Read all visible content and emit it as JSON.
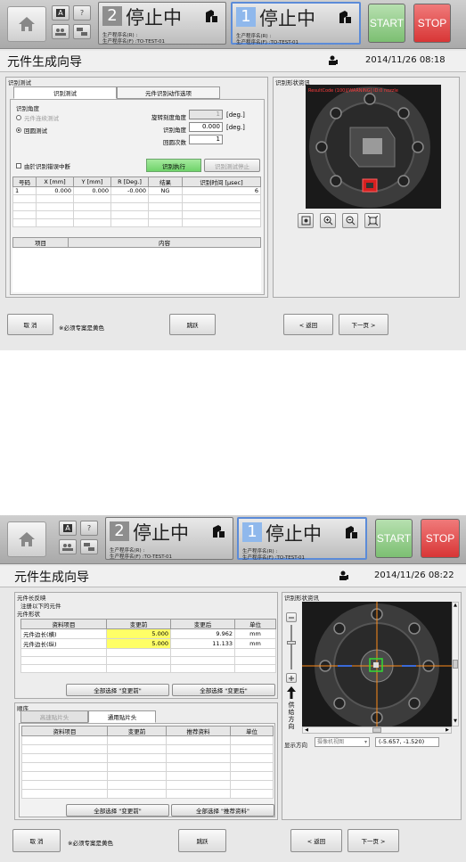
{
  "header": {
    "panel_left": {
      "number": "2",
      "status": "停止中",
      "line1": "生产程序名(R) :",
      "line2": "生产程序名(F) :TO-TEST-01"
    },
    "panel_right": {
      "number": "1",
      "status": "停止中",
      "line1": "生产程序名(R) :",
      "line2": "生产程序名(F) :TO-TEST-01"
    },
    "start_label": "START",
    "stop_label": "STOP",
    "small_btn_a": "A",
    "small_btn_q": "?"
  },
  "screen1": {
    "title": "元件生成向导",
    "datetime": "2014/11/26 08:18",
    "recog_test_group": "识别测试",
    "tabs": [
      "识别测试",
      "元件识别动作选项"
    ],
    "recog_angle_group": "识别角度",
    "radio_continuous": "元件连续测试",
    "radio_rotation": "回圆测试",
    "rot_step_label": "旋转刻度角度",
    "rot_step_value": "1",
    "recog_angle_label": "识别角度",
    "recog_angle_value": "0.000",
    "rotate_count_label": "回圆次数",
    "rotate_count_value": "1",
    "deg": "[deg.]",
    "stop_on_error": "由於识别错误中断",
    "execute_btn": "识别执行",
    "stop_test_btn": "识别测试停止",
    "result_headers": [
      "号码",
      "X [mm]",
      "Y [mm]",
      "R [Deg.]",
      "结果",
      "识别时间 [µsec]"
    ],
    "result_rows": [
      [
        "1",
        "0.000",
        "0.000",
        "-0.000",
        "NG",
        "6"
      ]
    ],
    "msg_headers": [
      "项目",
      "内容"
    ],
    "image_group": "识别形状资讯",
    "cancel_btn": "取 消",
    "required_note": "※必须专案是黄色",
    "skip_btn": "跳跃",
    "back_btn": "< 返回",
    "next_btn": "下一页 >",
    "overlay_text": "ResultCode (100)[WARNING] ID:0 nozzle"
  },
  "screen2": {
    "title": "元件生成向导",
    "datetime": "2014/11/26 08:22",
    "size_group": "元件长反映",
    "register_text": "注册以下的元件",
    "shape_group": "元件形状",
    "shape_headers": [
      "资料项目",
      "变更前",
      "变更后",
      "单位"
    ],
    "shape_rows": [
      [
        "元件边长(横)",
        "5.000",
        "9.962",
        "mm"
      ],
      [
        "元件边长(纵)",
        "5.000",
        "11.133",
        "mm"
      ]
    ],
    "select_before": "全部选择 \"变更前\"",
    "select_after": "全部选择 \"变更后\"",
    "order_group": "顺序",
    "tabs": [
      "高速贴片头",
      "通用贴片头"
    ],
    "order_headers": [
      "资料项目",
      "变更前",
      "推荐资料",
      "单位"
    ],
    "select_before2": "全部选择 \"变更前\"",
    "select_recommend": "全部选择 \"推荐资料\"",
    "image_group": "识别形状资讯",
    "feed_dir": "供给方向",
    "display_dir_label": "显示方向",
    "display_dir_value": "摄像机视图",
    "coords": "(-5.657, -1.520)",
    "cancel_btn": "取 消",
    "required_note": "※必须专案是黄色",
    "skip_btn": "跳跃",
    "back_btn": "< 返回",
    "next_btn": "下一页 >"
  },
  "colors": {
    "accent_blue": "#5b8bd8",
    "start_green": "#7cbf72",
    "stop_red": "#d83636",
    "required_yellow": "#ffff66",
    "execute_green": "#6fd36a"
  }
}
